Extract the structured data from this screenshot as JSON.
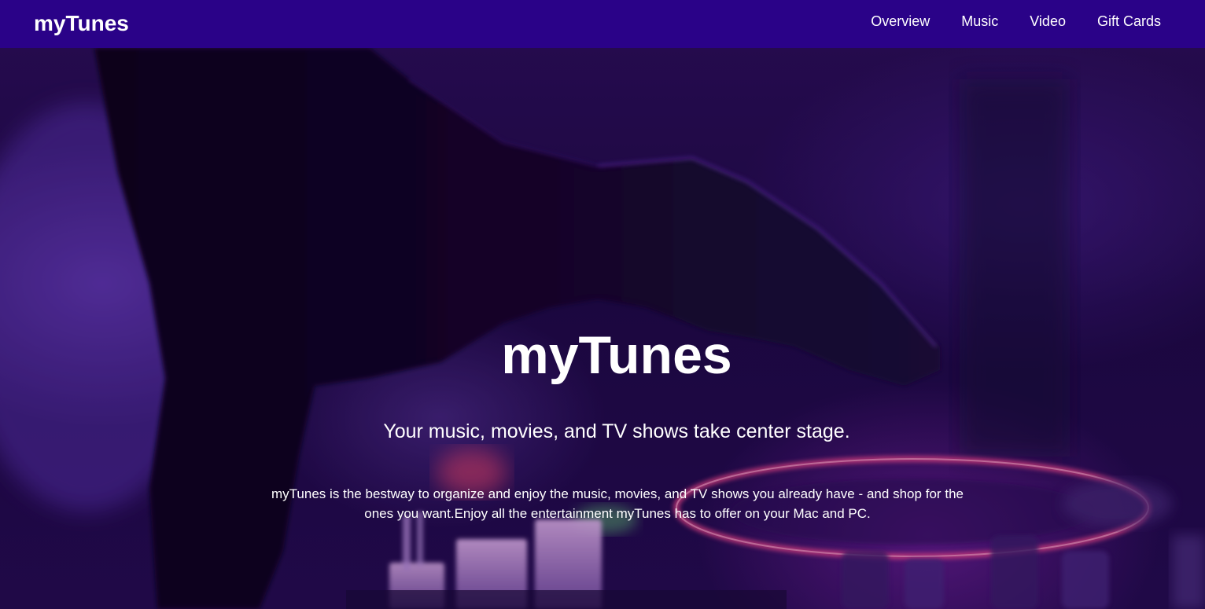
{
  "navbar": {
    "brand": "myTunes",
    "links": [
      "Overview",
      "Music",
      "Video",
      "Gift Cards"
    ]
  },
  "hero": {
    "title": "myTunes",
    "subtitle": "Your music, movies, and TV shows take center stage.",
    "body": "myTunes is the bestway to organize and enjoy the music, movies, and TV shows you already have - and shop for the ones you want.Enjoy all the entertainment myTunes has to offer on your Mac and PC.",
    "background": "dj-turntable-hand-photo"
  },
  "colors": {
    "navbar_bg": "#2a0288",
    "text": "#ffffff",
    "hero_tint": "#2a0d55",
    "accent_pink": "#ff3a8c"
  }
}
